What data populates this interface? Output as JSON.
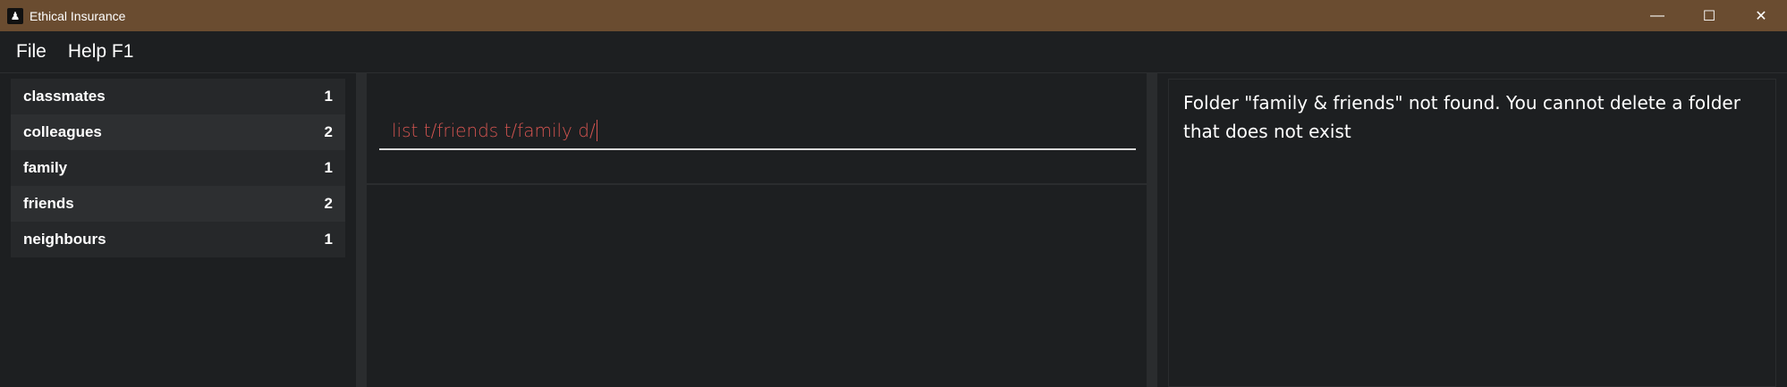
{
  "window": {
    "title": "Ethical Insurance",
    "icon": "app-logo-icon",
    "controls": [
      {
        "name": "minimize-icon",
        "glyph": "—"
      },
      {
        "name": "maximize-icon",
        "glyph": "☐"
      },
      {
        "name": "close-icon",
        "glyph": "✕"
      }
    ]
  },
  "menu": {
    "file_label": "File",
    "help_label": "Help F1"
  },
  "folders": [
    {
      "name": "classmates",
      "count": "1"
    },
    {
      "name": "colleagues",
      "count": "2"
    },
    {
      "name": "family",
      "count": "1"
    },
    {
      "name": "friends",
      "count": "2"
    },
    {
      "name": "neighbours",
      "count": "1"
    }
  ],
  "command": {
    "value": "list t/friends t/family d/"
  },
  "result": {
    "message": "Folder \"family & friends\" not found. You cannot delete a folder that does not exist"
  },
  "colors": {
    "titlebar": "#6a4c30",
    "background": "#1d1f21",
    "command_text": "#d35450"
  }
}
